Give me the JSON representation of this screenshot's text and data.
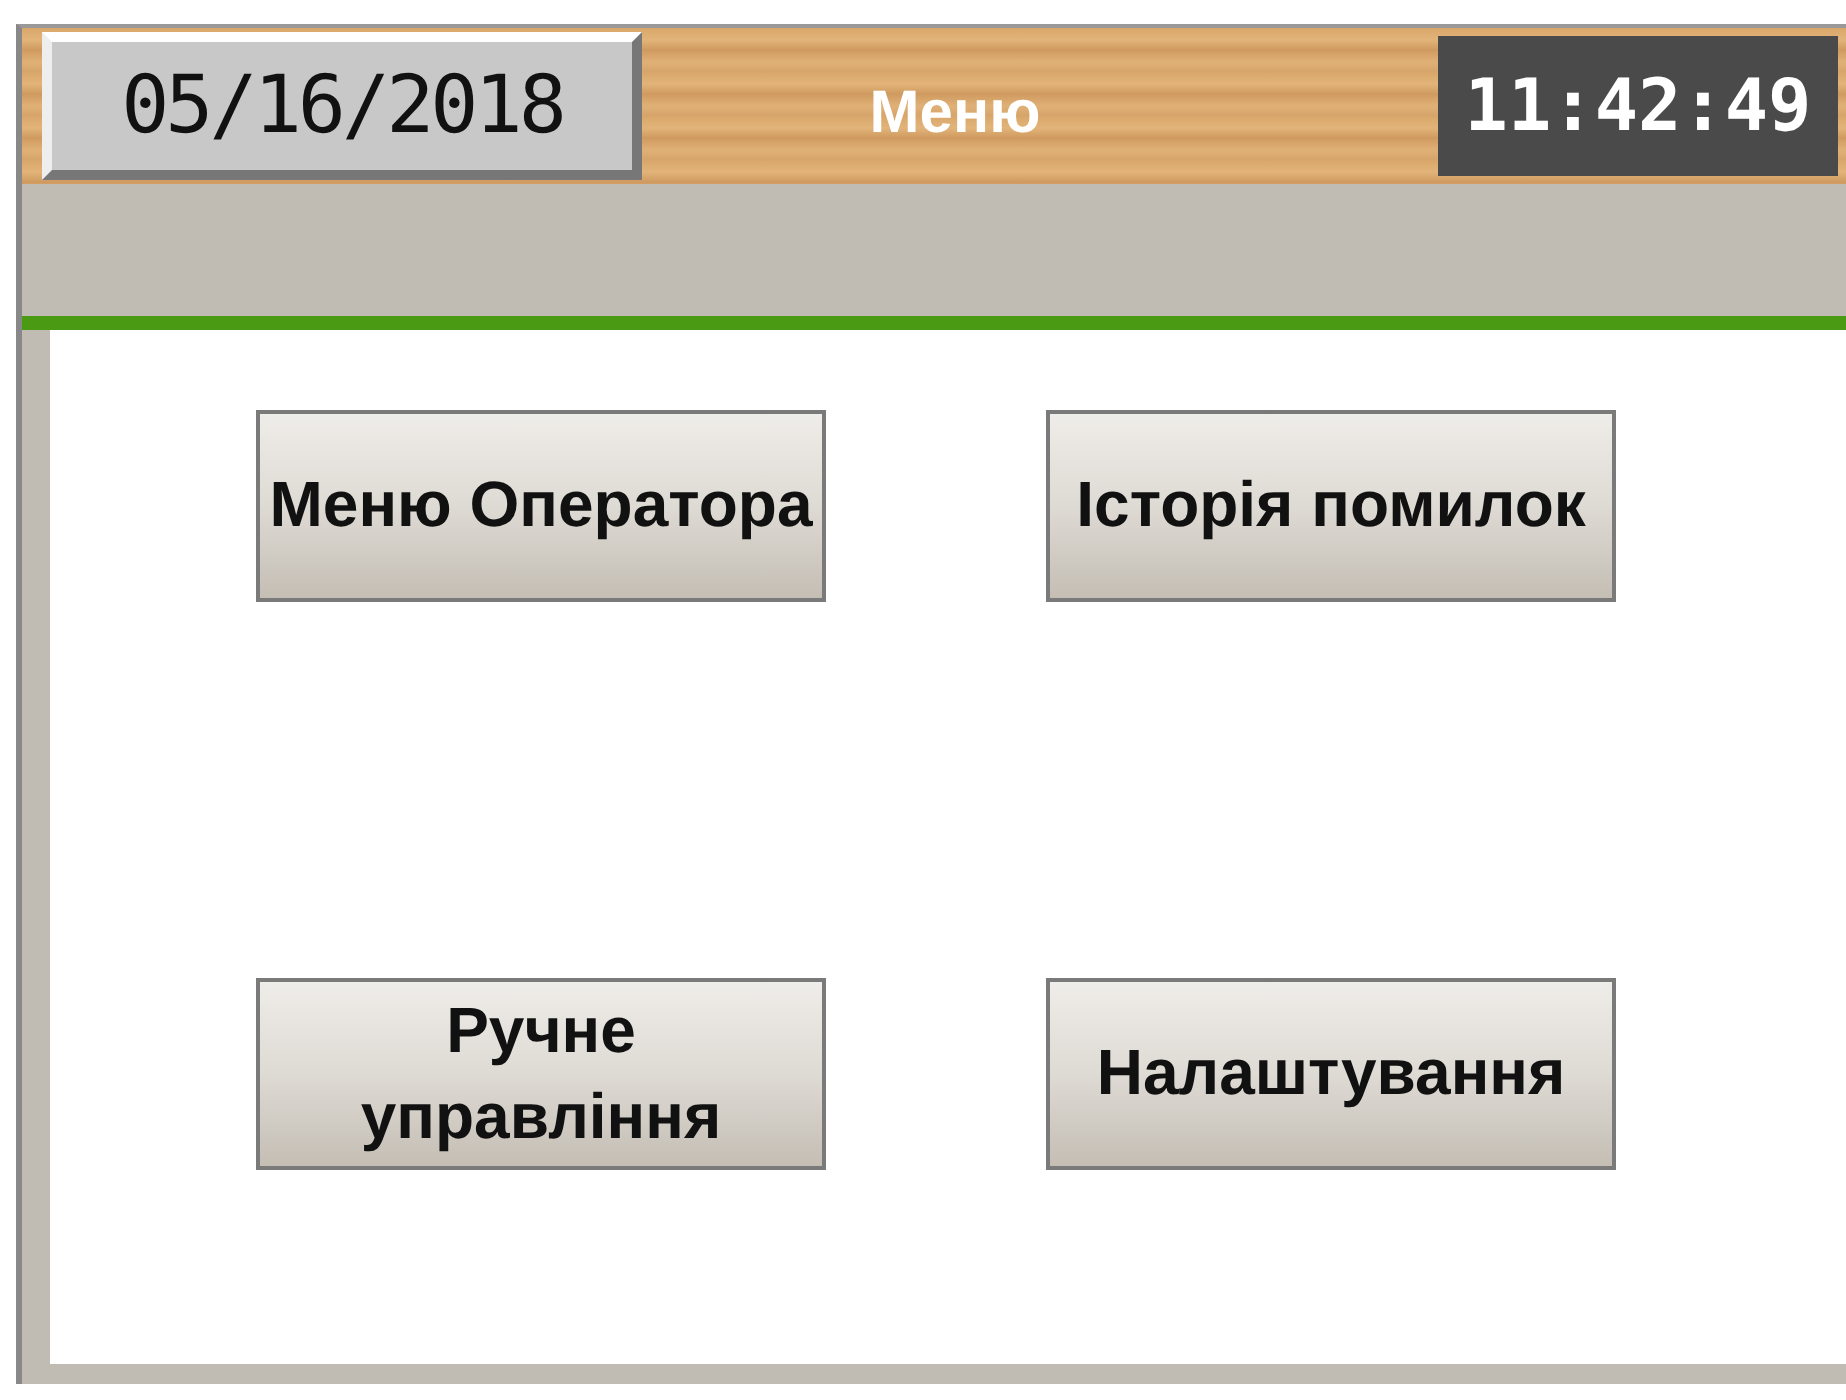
{
  "header": {
    "date": "05/16/2018",
    "title": "Меню",
    "time": "11:42:49"
  },
  "buttons": [
    {
      "label": "Меню Оператора"
    },
    {
      "label": "Історія помилок"
    },
    {
      "label": "Ручне управління"
    },
    {
      "label": "Налаштування"
    }
  ]
}
